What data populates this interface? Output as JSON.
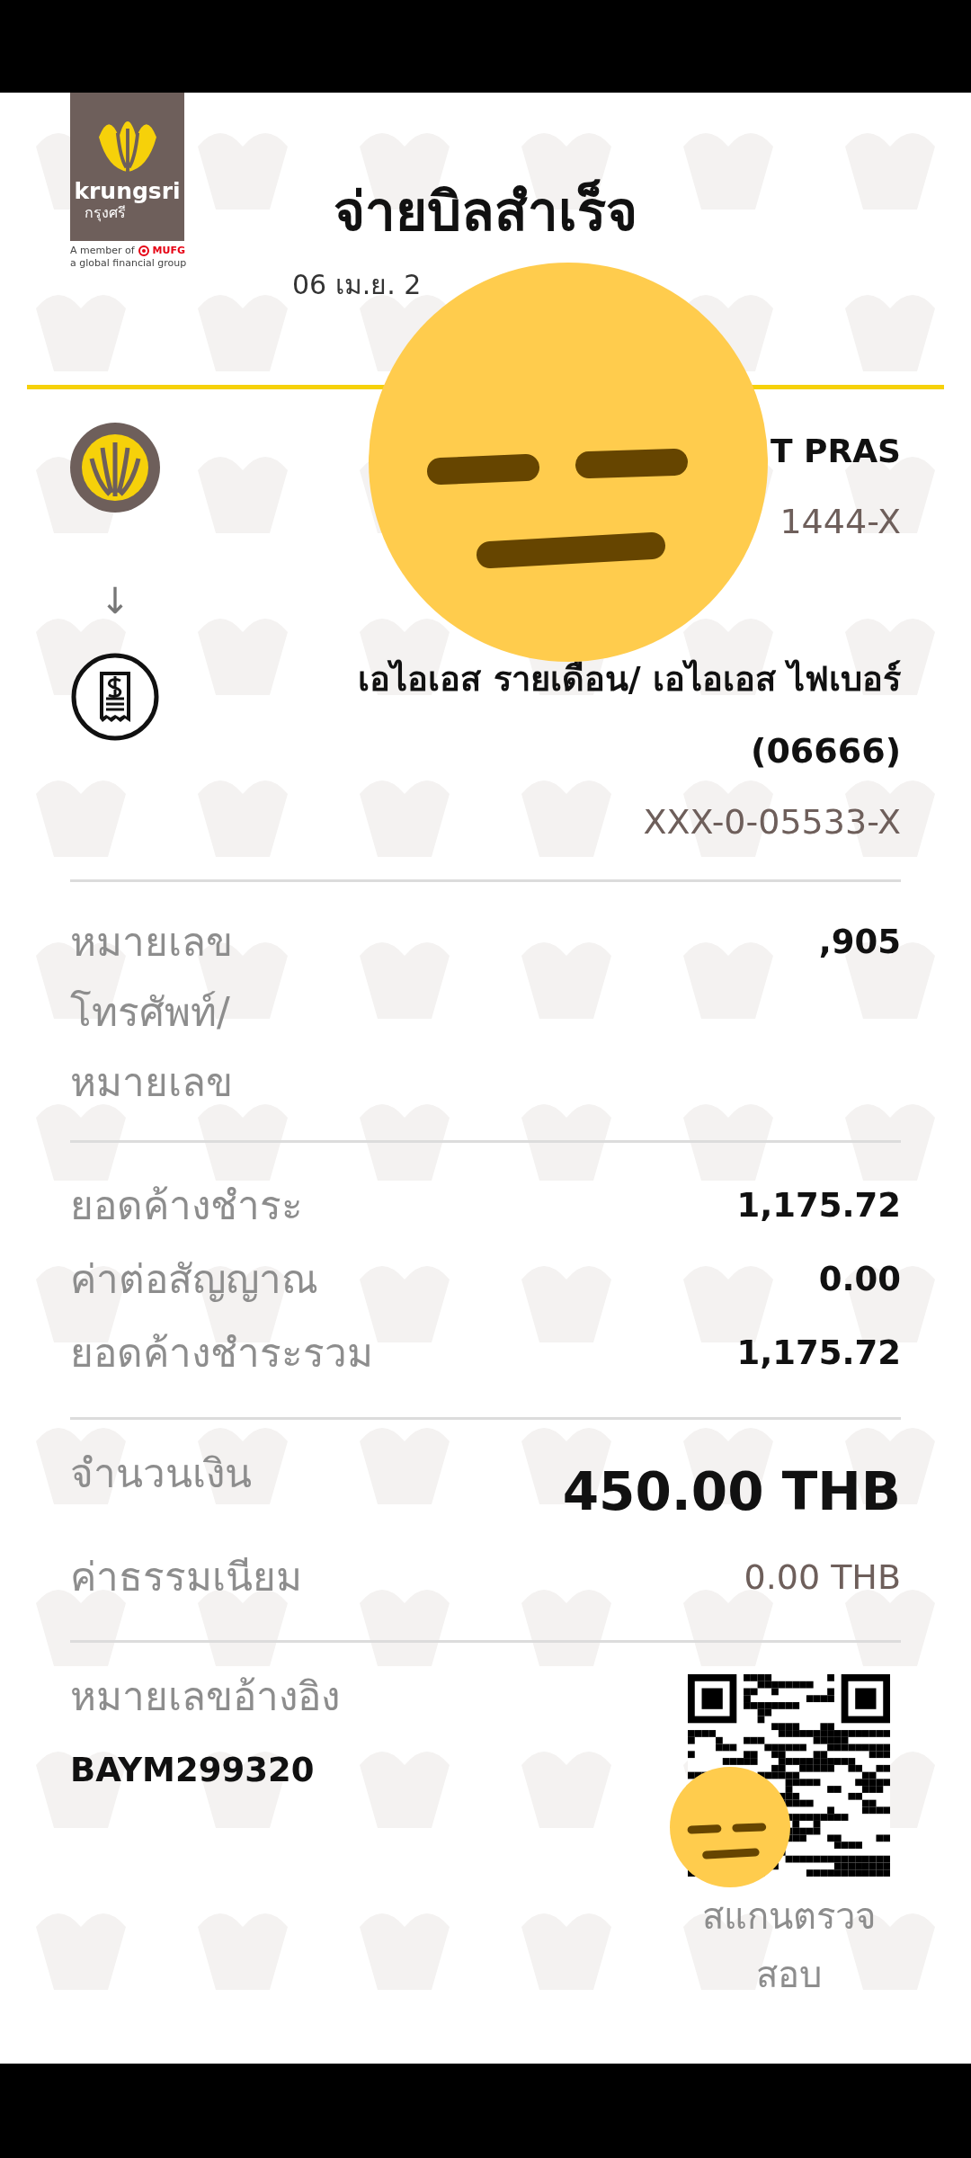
{
  "logo": {
    "brand": "krungsri",
    "brand_thai": "กรุงศรี",
    "member": "A member of",
    "group": "MUFG",
    "tagline": "a global financial group"
  },
  "title": "จ่ายบิลสำเร็จ",
  "date": "06 เม.ย. 2",
  "from": {
    "name": "T PRAS",
    "account": "1444-X"
  },
  "arrow": "↓",
  "to": {
    "name": "เอไอเอส รายเดือน/ เอไอเอส ไฟเบอร์ (06666)",
    "account": "XXX-0-05533-X"
  },
  "phone": {
    "label": "หมายเลขโทรศัพท์/หมายเลข",
    "value": ",905"
  },
  "bills": [
    {
      "label": "ยอดค้างชำระ",
      "value": "1,175.72"
    },
    {
      "label": "ค่าต่อสัญญาณ",
      "value": "0.00"
    },
    {
      "label": "ยอดค้างชำระรวม",
      "value": "1,175.72"
    }
  ],
  "amount": {
    "label": "จำนวนเงิน",
    "value": "450.00 THB"
  },
  "fee": {
    "label": "ค่าธรรมเนียม",
    "value": "0.00 THB"
  },
  "reference": {
    "label": "หมายเลขอ้างอิง",
    "value": "BAYM299320"
  },
  "qr": {
    "caption": "สแกนตรวจสอบ"
  }
}
